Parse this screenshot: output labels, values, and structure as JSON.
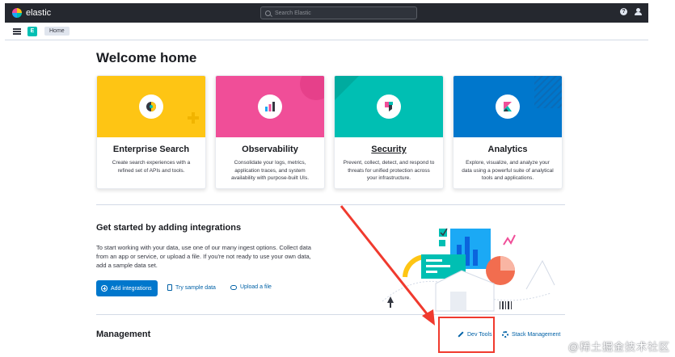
{
  "header": {
    "logo_text": "elastic",
    "search_placeholder": "Search Elastic",
    "help_icon": "help-icon",
    "user_icon": "user-menu-icon"
  },
  "breadcrumbs": {
    "space_initial": "E",
    "current": "Home"
  },
  "page": {
    "title": "Welcome home"
  },
  "solutions": [
    {
      "title": "Enterprise Search",
      "description": "Create search experiences with a refined set of APIs and tools.",
      "color": "#fec514",
      "icon": "enterprise-search-icon"
    },
    {
      "title": "Observability",
      "description": "Consolidate your logs, metrics, application traces, and system availability with purpose-built UIs.",
      "color": "#f04e98",
      "icon": "observability-icon"
    },
    {
      "title": "Security",
      "description": "Prevent, collect, detect, and respond to threats for unified protection across your infrastructure.",
      "color": "#00bfb3",
      "icon": "security-icon"
    },
    {
      "title": "Analytics",
      "description": "Explore, visualize, and analyze your data using a powerful suite of analytical tools and applications.",
      "color": "#0077cc",
      "icon": "kibana-icon"
    }
  ],
  "integrations": {
    "title": "Get started by adding integrations",
    "description": "To start working with your data, use one of our many ingest options. Collect data from an app or service, or upload a file. If you're not ready to use your own data, add a sample data set.",
    "add_button": "Add integrations",
    "sample_link": "Try sample data",
    "upload_link": "Upload a file"
  },
  "management": {
    "title": "Management",
    "dev_tools_link": "Dev Tools",
    "stack_management_link": "Stack Management"
  },
  "annotation": {
    "color": "#f03a2e"
  },
  "watermark": "@稀土掘金技术社区"
}
